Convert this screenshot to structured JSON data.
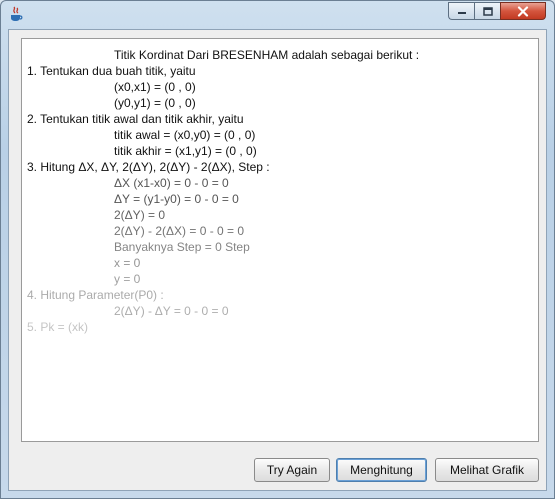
{
  "window": {
    "title": "",
    "controls": {
      "minimize": "minimize",
      "maximize": "maximize",
      "close": "close"
    }
  },
  "output": {
    "lines": [
      {
        "text": "Titik Kordinat Dari BRESENHAM adalah sebagai berikut :",
        "indent": 1
      },
      {
        "text": "1. Tentukan dua buah titik, yaitu",
        "indent": 0
      },
      {
        "text": "(x0,x1) = (0 , 0)",
        "indent": 1
      },
      {
        "text": "(y0,y1) = (0 , 0)",
        "indent": 1
      },
      {
        "text": "2. Tentukan titik awal dan titik akhir, yaitu",
        "indent": 0
      },
      {
        "text": "titik awal = (x0,y0) = (0 , 0)",
        "indent": 1
      },
      {
        "text": "titik akhir = (x1,y1) = (0 , 0)",
        "indent": 1
      },
      {
        "text": "3. Hitung ΔX, ΔY, 2(ΔY), 2(ΔY) - 2(ΔX), Step :",
        "indent": 0
      },
      {
        "text": "ΔX (x1-x0) = 0 - 0 = 0",
        "indent": 1
      },
      {
        "text": "ΔY = (y1-y0) = 0 - 0 = 0",
        "indent": 1
      },
      {
        "text": "2(ΔY) = 0",
        "indent": 1
      },
      {
        "text": "2(ΔY) - 2(ΔX) = 0 - 0 = 0",
        "indent": 1
      },
      {
        "text": "Banyaknya Step = 0 Step",
        "indent": 1
      },
      {
        "text": "x = 0",
        "indent": 1
      },
      {
        "text": "y = 0",
        "indent": 1
      },
      {
        "text": "4. Hitung Parameter(P0) :",
        "indent": 0
      },
      {
        "text": "2(ΔY) - ΔY = 0 - 0 = 0",
        "indent": 1
      },
      {
        "text": "5. Pk = (xk)",
        "indent": 0
      }
    ]
  },
  "buttons": {
    "try_again": "Try Again",
    "menghitung": "Menghitung",
    "melihat_grafik": "Melihat Grafik"
  }
}
